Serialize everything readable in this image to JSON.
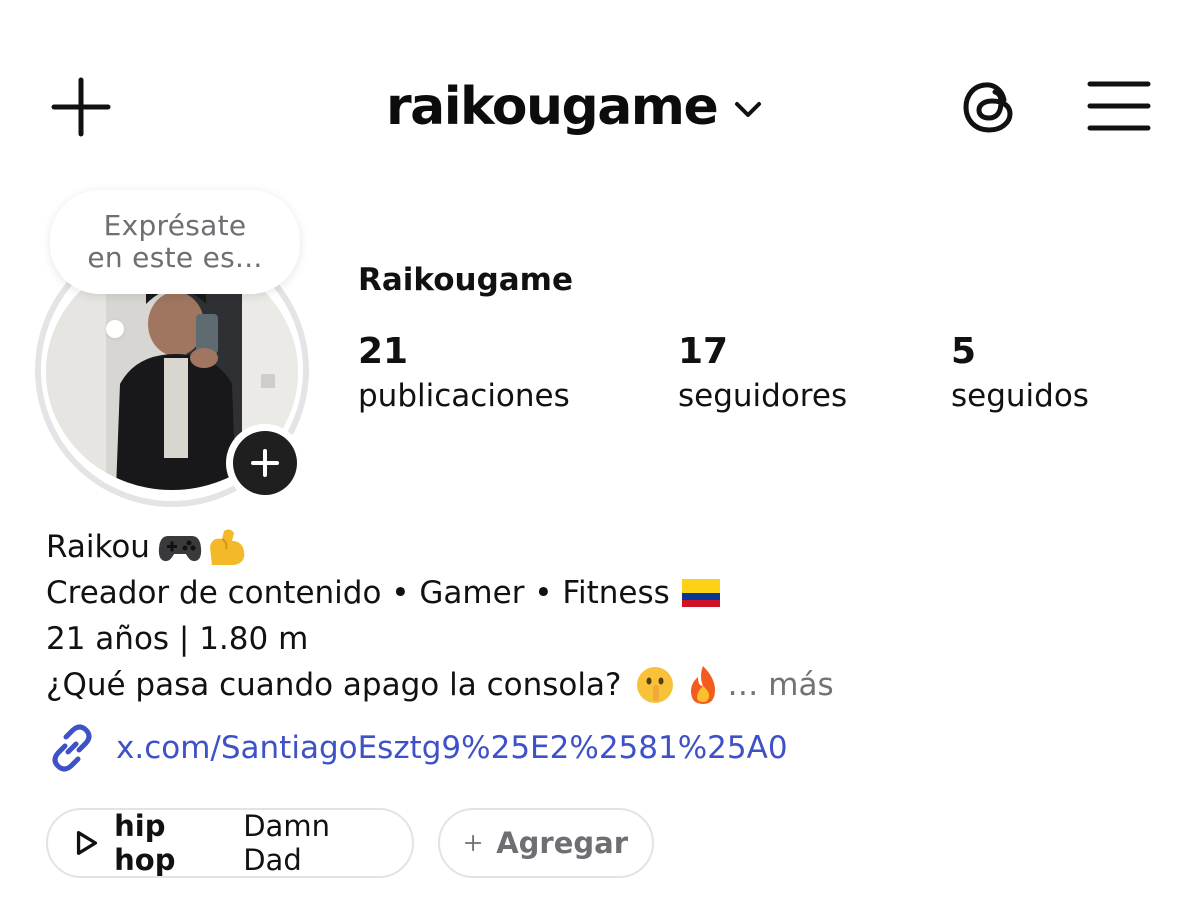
{
  "header": {
    "username": "raikougame"
  },
  "note": {
    "line1": "Exprésate",
    "line2": "en este es..."
  },
  "profile": {
    "display_name": "Raikougame",
    "stats": [
      {
        "count": "21",
        "label": "publicaciones"
      },
      {
        "count": "17",
        "label": "seguidores"
      },
      {
        "count": "5",
        "label": "seguidos"
      }
    ]
  },
  "bio": {
    "name_line": "Raikou",
    "line2": "Creador de contenido • Gamer • Fitness",
    "line3": "21 años | 1.80 m",
    "line4": "¿Qué pasa cuando apago la consola?",
    "more": "… más",
    "link": "x.com/SantiagoEsztg9%25E2%2581%25A0"
  },
  "chips": {
    "music_genre": "hip hop",
    "music_track": "Damn Dad",
    "add_label": "Agregar"
  },
  "icons": {
    "new_post": "plus-icon",
    "dropdown": "chevron-down-icon",
    "threads": "threads-icon",
    "menu": "hamburger-menu-icon",
    "link": "link-icon",
    "play": "play-icon"
  },
  "colors": {
    "link": "#3f51c7",
    "muted": "#6e6e73",
    "text": "#111111"
  }
}
